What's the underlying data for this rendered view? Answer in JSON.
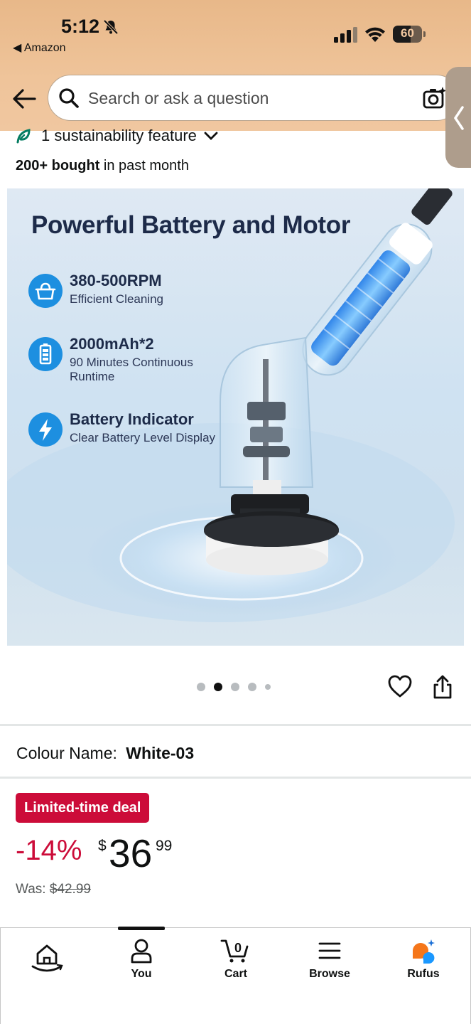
{
  "status_bar": {
    "time": "5:12",
    "back_app": "◀ Amazon",
    "battery": "60",
    "battery_level": 0.6
  },
  "search": {
    "placeholder": "Search or ask a question"
  },
  "sustainability": {
    "label": "1 sustainability feature"
  },
  "social_proof": {
    "bold": "200+ bought",
    "rest": " in past month"
  },
  "product_image": {
    "title": "Powerful Battery and Motor",
    "features": [
      {
        "icon": "basket-icon",
        "title": "380-500RPM",
        "desc": "Efficient Cleaning"
      },
      {
        "icon": "battery-icon",
        "title": "2000mAh*2",
        "desc": "90 Minutes Continuous Runtime"
      },
      {
        "icon": "bolt-icon",
        "title": "Battery Indicator",
        "desc": "Clear Battery Level Display"
      }
    ],
    "carousel_active_index": 1,
    "carousel_count": 5
  },
  "variant": {
    "label": "Colour Name:",
    "value": "White-03"
  },
  "pricing": {
    "deal_badge": "Limited-time deal",
    "discount": "-14%",
    "currency": "$",
    "whole": "36",
    "fraction": "99",
    "was_label": "Was:",
    "was_price": "$42.99"
  },
  "bottom_nav": {
    "home": "",
    "you": "You",
    "cart": "Cart",
    "cart_count": "0",
    "browse": "Browse",
    "rufus": "Rufus"
  },
  "colors": {
    "header_bg": "#efc49a",
    "deal_red": "#cc0c39",
    "icon_blue": "#1d8fe0"
  }
}
